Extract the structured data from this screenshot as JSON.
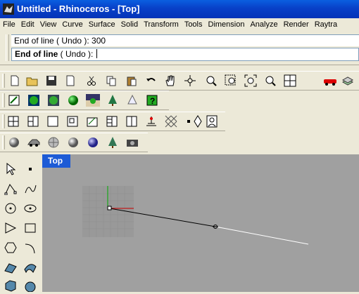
{
  "window": {
    "title": "Untitled - Rhinoceros - [Top]"
  },
  "menu": [
    "File",
    "Edit",
    "View",
    "Curve",
    "Surface",
    "Solid",
    "Transform",
    "Tools",
    "Dimension",
    "Analyze",
    "Render",
    "Raytra"
  ],
  "command": {
    "history": "End of line ( Undo ): 300",
    "prompt_bold": "End of line",
    "prompt_rest": " ( Undo ): "
  },
  "viewport": {
    "label": "Top"
  },
  "toolbars": {
    "row1": [
      "new-file-icon",
      "open-file-icon",
      "save-icon",
      "print-icon",
      "cut-icon",
      "copy-icon",
      "paste-icon",
      "undo-icon",
      "pan-hand-icon",
      "rotate-view-icon",
      "zoom-dynamic-icon",
      "zoom-window-icon",
      "zoom-extents-icon",
      "zoom-selected-icon",
      "four-viewports-icon",
      "car-render-icon",
      "layers-icon"
    ],
    "row2": [
      "properties-icon",
      "render-sphere-icon",
      "shaded-sphere-icon",
      "green-sphere-icon",
      "environment-icon",
      "tree-icon",
      "spotlight-icon",
      "help-icon"
    ],
    "row3": [
      "four-view-icon",
      "three-view-icon",
      "single-view-icon",
      "maximize-view-icon",
      "set-view-icon",
      "named-view-icon",
      "two-view-icon",
      "cplane-icon",
      "hatch-icon",
      "point-icon",
      "diamond-icon",
      "portrait-icon"
    ],
    "row4": [
      "wireframe-sphere-icon",
      "car-shaded-icon",
      "ghosted-sphere-icon",
      "gray-sphere-icon",
      "blue-sphere-icon",
      "environment-render-icon",
      "camera-icon"
    ],
    "left": [
      "select-arrow-icon",
      "point-tool-icon",
      "polyline-icon",
      "curve-tool-icon",
      "circle-tool-icon",
      "ellipse-tool-icon",
      "arc-rect-icon",
      "rectangle-icon",
      "polygon-icon",
      "arc-icon",
      "surface-corner-icon",
      "surface-edge-icon",
      "box-solid-icon",
      "sphere-solid-icon"
    ]
  },
  "colors": {
    "titlebar": "#0a5fe0",
    "viewport": "#a0a0a0",
    "tab": "#1d5bd6"
  }
}
